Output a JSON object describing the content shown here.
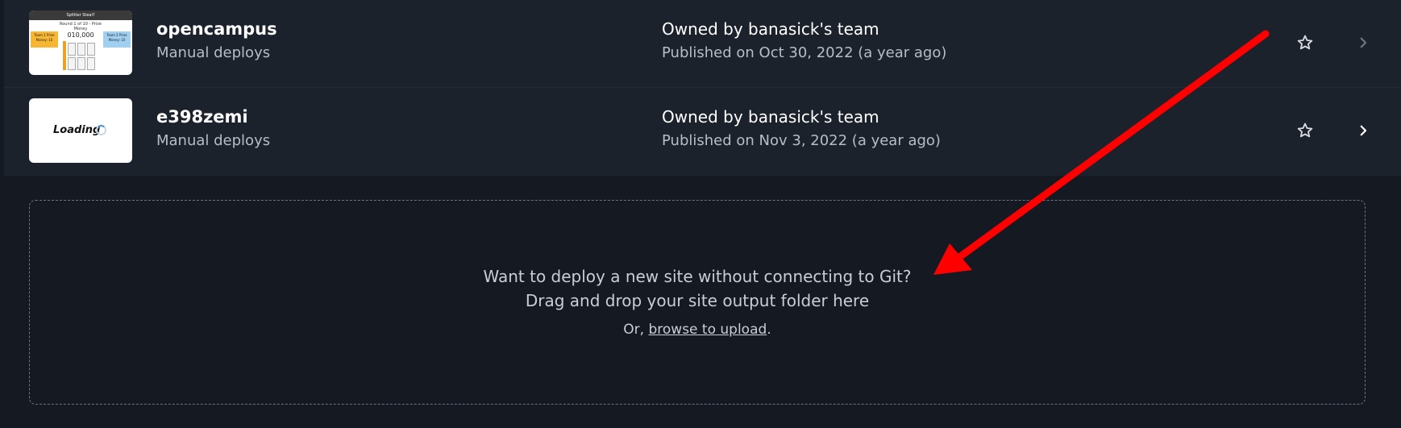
{
  "sites": [
    {
      "name": "opencampus",
      "deploy_type": "Manual deploys",
      "owner": "Owned by banasick's team",
      "published": "Published on Oct 30, 2022 (a year ago)",
      "thumbnail": {
        "kind": "screenshot",
        "header": "Splitter Steal?",
        "round": "Round 1 of 10 - Prize Money",
        "amount": "010,000",
        "team_left": "Team 1 Prize Money: 10",
        "team_right": "Team 2 Prize Money: 10"
      },
      "star_icon": "star-outline-icon",
      "chevron_icon": "chevron-right-icon",
      "chevron_color": "#6b7480"
    },
    {
      "name": "e398zemi",
      "deploy_type": "Manual deploys",
      "owner": "Owned by banasick's team",
      "published": "Published on Nov 3, 2022 (a year ago)",
      "thumbnail": {
        "kind": "loading",
        "label": "Loading"
      },
      "star_icon": "star-outline-icon",
      "chevron_icon": "chevron-right-icon",
      "chevron_color": "#ffffff"
    }
  ],
  "dropzone": {
    "line1": "Want to deploy a new site without connecting to Git?",
    "line2": "Drag and drop your site output folder here",
    "or_prefix": "Or, ",
    "browse_link": "browse to upload",
    "suffix": "."
  },
  "annotation": {
    "type": "arrow",
    "color": "#ff0000"
  }
}
